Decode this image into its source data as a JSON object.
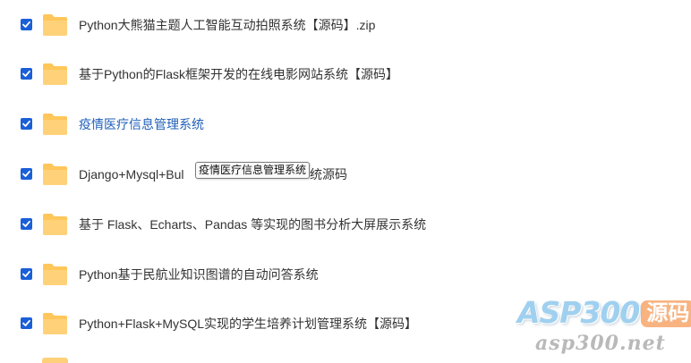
{
  "files": [
    {
      "name": "Python大熊猫主题人工智能互动拍照系统【源码】.zip",
      "checked": true
    },
    {
      "name": "基于Python的Flask框架开发的在线电影网站系统【源码】",
      "checked": true
    },
    {
      "name": "疫情医疗信息管理系统",
      "checked": true
    },
    {
      "name": "Django+Mysql+Bul",
      "name_tail": "统源码",
      "checked": true
    },
    {
      "name": "基于 Flask、Echarts、Pandas 等实现的图书分析大屏展示系统",
      "checked": true
    },
    {
      "name": "Python基于民航业知识图谱的自动问答系统",
      "checked": true
    },
    {
      "name": "Python+Flask+MySQL实现的学生培养计划管理系统【源码】",
      "checked": true
    }
  ],
  "tooltip": {
    "text": "疫情医疗信息管理系统"
  },
  "watermark": {
    "brand": "ASP300",
    "badge": "源码",
    "url": "asp300.net"
  },
  "colors": {
    "checkbox": "#1a5fd8",
    "folder": "#ffc65a",
    "active_link": "#1f5fb8",
    "text": "#333333"
  },
  "icons": {
    "checkbox": "checkbox-checked-icon",
    "folder": "folder-icon"
  }
}
